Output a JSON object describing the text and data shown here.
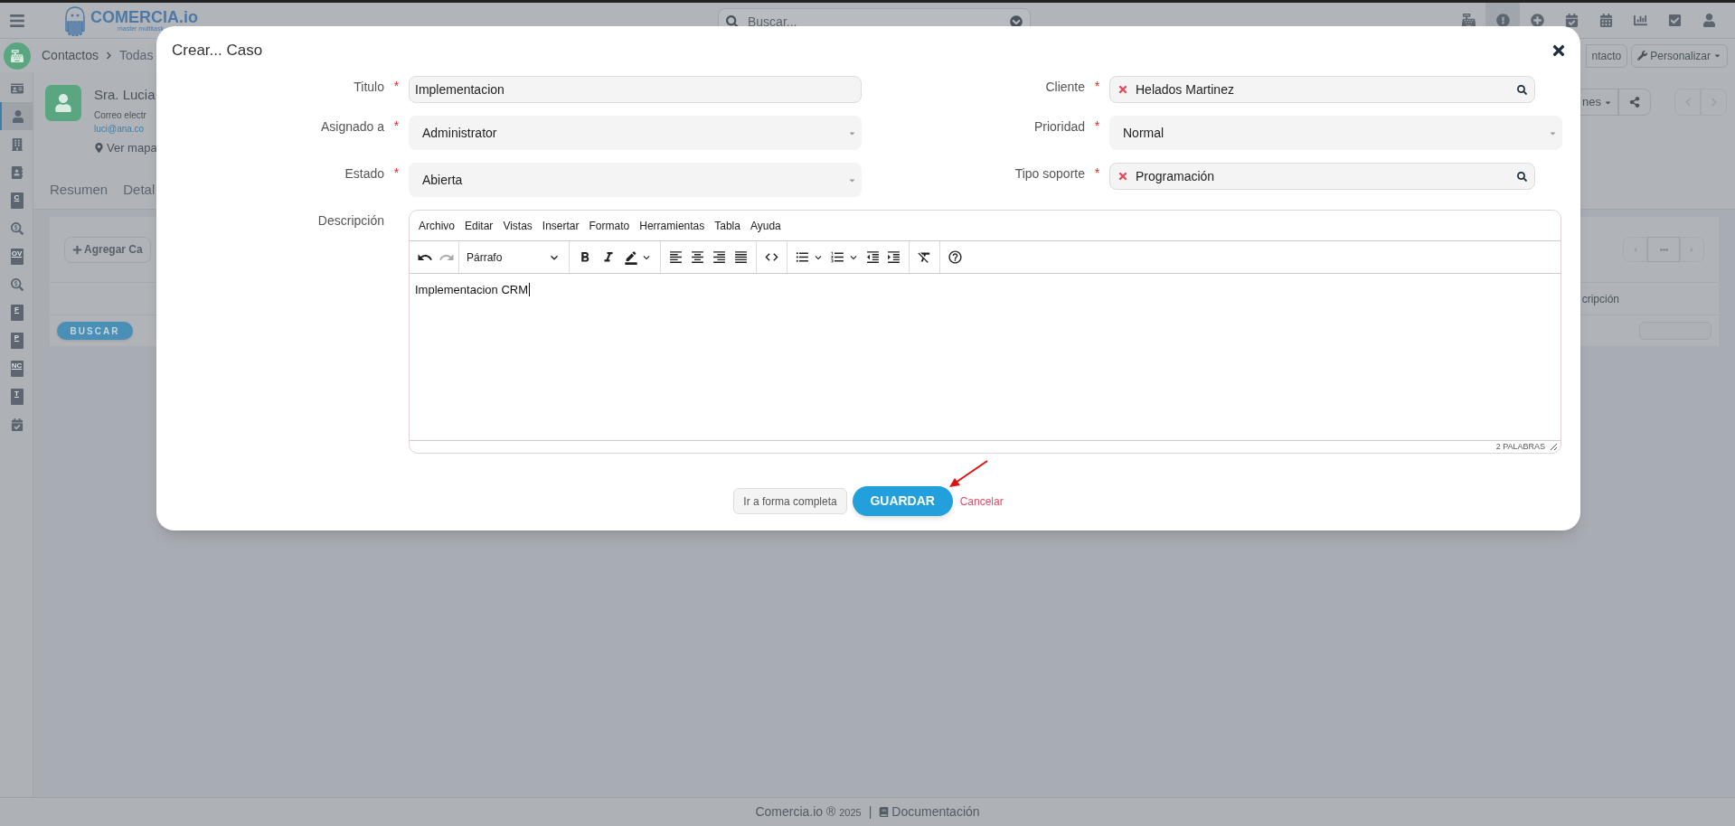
{
  "topbar": {
    "logo_name": "COMERCIA.io",
    "logo_tagline": "master multitask",
    "search": {
      "placeholder": "Buscar..."
    },
    "icons": [
      {
        "selected": false
      },
      {
        "selected": true
      },
      {
        "selected": false
      },
      {
        "selected": false
      },
      {
        "selected": false
      },
      {
        "selected": false
      },
      {
        "selected": false
      },
      {
        "selected": false
      }
    ]
  },
  "breadcrumb": [
    "Contactos",
    "Todas"
  ],
  "sidebar": {
    "items": [
      {
        "kind": "icon",
        "selected": false
      },
      {
        "kind": "icon",
        "selected": true
      },
      {
        "kind": "icon",
        "selected": false
      },
      {
        "kind": "icon",
        "selected": false
      },
      {
        "kind": "doc",
        "letter": "C",
        "selected": false
      },
      {
        "kind": "icon",
        "selected": false
      },
      {
        "kind": "doc",
        "letter": "OV",
        "selected": false
      },
      {
        "kind": "icon",
        "selected": false
      },
      {
        "kind": "doc",
        "letter": "F",
        "selected": false
      },
      {
        "kind": "doc",
        "letter": "P",
        "selected": false
      },
      {
        "kind": "doc",
        "letter": "NC",
        "selected": false
      },
      {
        "kind": "doc",
        "letter": "T",
        "selected": false
      },
      {
        "kind": "icon",
        "selected": false
      }
    ]
  },
  "contact": {
    "name": "Sra. Lucia",
    "email_label": "Correo electr",
    "email": "luci@ana.co",
    "map_link": "Ver mapa"
  },
  "tabs": [
    "Resumen",
    "Detal"
  ],
  "background": {
    "add_button": "Agregar Ca",
    "search_button": "BUSCAR",
    "contact_button": "ntacto",
    "customize_button": "Personalizar",
    "actions_button": "nes",
    "column_header": "cripción"
  },
  "modal": {
    "title": "Crear... Caso",
    "left_fields": [
      {
        "label": "Titulo",
        "required_mark": "*",
        "kind": "text",
        "value": "Implementacion"
      },
      {
        "label": "Asignado a",
        "required_mark": "*",
        "kind": "select",
        "value": "Administrator"
      },
      {
        "label": "Estado",
        "required_mark": "*",
        "kind": "select",
        "value": "Abierta"
      }
    ],
    "right_fields": [
      {
        "label": "Cliente",
        "required_mark": "*",
        "kind": "lookup",
        "value": "Helados Martinez"
      },
      {
        "label": "Prioridad",
        "required_mark": "*",
        "kind": "select",
        "value": "Normal"
      },
      {
        "label": "Tipo soporte",
        "required_mark": "*",
        "kind": "lookup",
        "value": "Programación"
      }
    ],
    "description": {
      "label": "Descripción",
      "menu": [
        "Archivo",
        "Editar",
        "Vistas",
        "Insertar",
        "Formato",
        "Herramientas",
        "Tabla",
        "Ayuda"
      ],
      "block_format": "Párrafo",
      "content": "Implementacion CRM",
      "word_count": "2 PALABRAS"
    },
    "buttons": {
      "full_form": "Ir a forma completa",
      "save": "GUARDAR",
      "cancel": "Cancelar"
    }
  },
  "footer": {
    "copyright": "Comercia.io ®",
    "year": "2025",
    "separator": "|",
    "docs_link": "Documentación"
  }
}
